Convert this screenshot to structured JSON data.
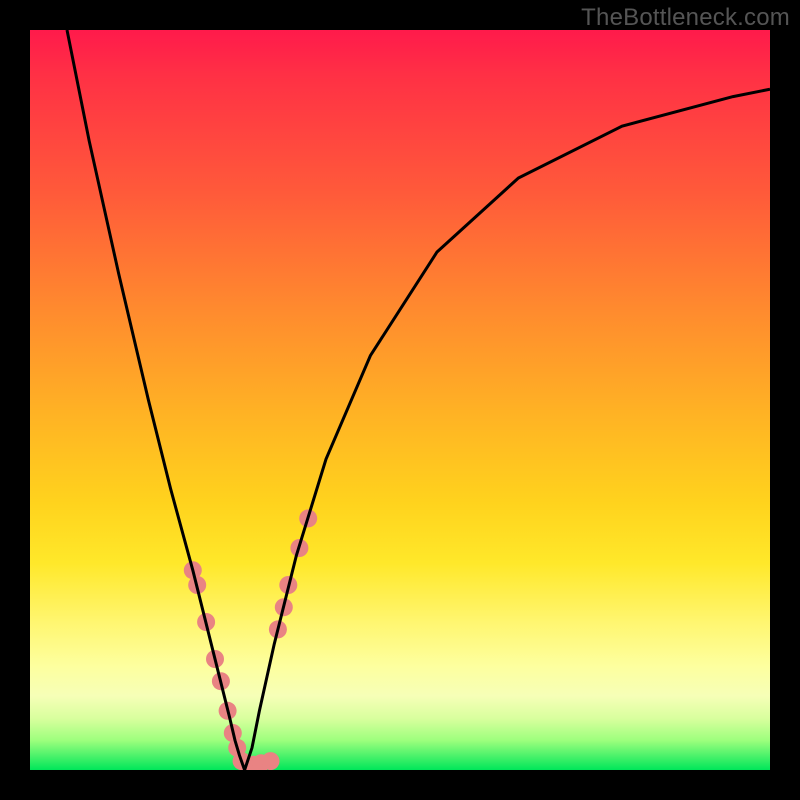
{
  "watermark": "TheBottleneck.com",
  "colors": {
    "background": "#000000",
    "gradient_top": "#ff1a4b",
    "gradient_mid1": "#ff8b2e",
    "gradient_mid2": "#ffe82a",
    "gradient_band": "#fdff9f",
    "gradient_bottom": "#00e65a",
    "curve": "#000000",
    "marker": "#e98383",
    "watermark": "#555555"
  },
  "chart_data": {
    "type": "line",
    "title": "",
    "xlabel": "",
    "ylabel": "",
    "xlim": [
      0,
      100
    ],
    "ylim": [
      0,
      100
    ],
    "series": [
      {
        "name": "left-branch",
        "x": [
          5,
          8,
          12,
          16,
          19,
          22,
          24,
          25,
          26,
          27,
          27.7,
          28.3,
          29
        ],
        "y": [
          100,
          85,
          67,
          50,
          38,
          27,
          19,
          15,
          11,
          7,
          4,
          2,
          0
        ]
      },
      {
        "name": "right-branch",
        "x": [
          29,
          30,
          31,
          33,
          36,
          40,
          46,
          55,
          66,
          80,
          95,
          100
        ],
        "y": [
          0,
          3,
          8,
          17,
          29,
          42,
          56,
          70,
          80,
          87,
          91,
          92
        ]
      }
    ],
    "markers": {
      "name": "highlighted-points",
      "color": "#e98383",
      "radius_px": 9,
      "points": [
        {
          "x": 22.0,
          "y": 27
        },
        {
          "x": 22.6,
          "y": 25
        },
        {
          "x": 23.8,
          "y": 20
        },
        {
          "x": 25.0,
          "y": 15
        },
        {
          "x": 25.8,
          "y": 12
        },
        {
          "x": 26.7,
          "y": 8
        },
        {
          "x": 27.4,
          "y": 5
        },
        {
          "x": 28.0,
          "y": 3
        },
        {
          "x": 28.6,
          "y": 1.2
        },
        {
          "x": 29.5,
          "y": 0.7
        },
        {
          "x": 30.2,
          "y": 0.7
        },
        {
          "x": 31.2,
          "y": 0.9
        },
        {
          "x": 32.5,
          "y": 1.2
        },
        {
          "x": 33.5,
          "y": 19
        },
        {
          "x": 34.3,
          "y": 22
        },
        {
          "x": 34.9,
          "y": 25
        },
        {
          "x": 36.4,
          "y": 30
        },
        {
          "x": 37.6,
          "y": 34
        }
      ]
    }
  }
}
